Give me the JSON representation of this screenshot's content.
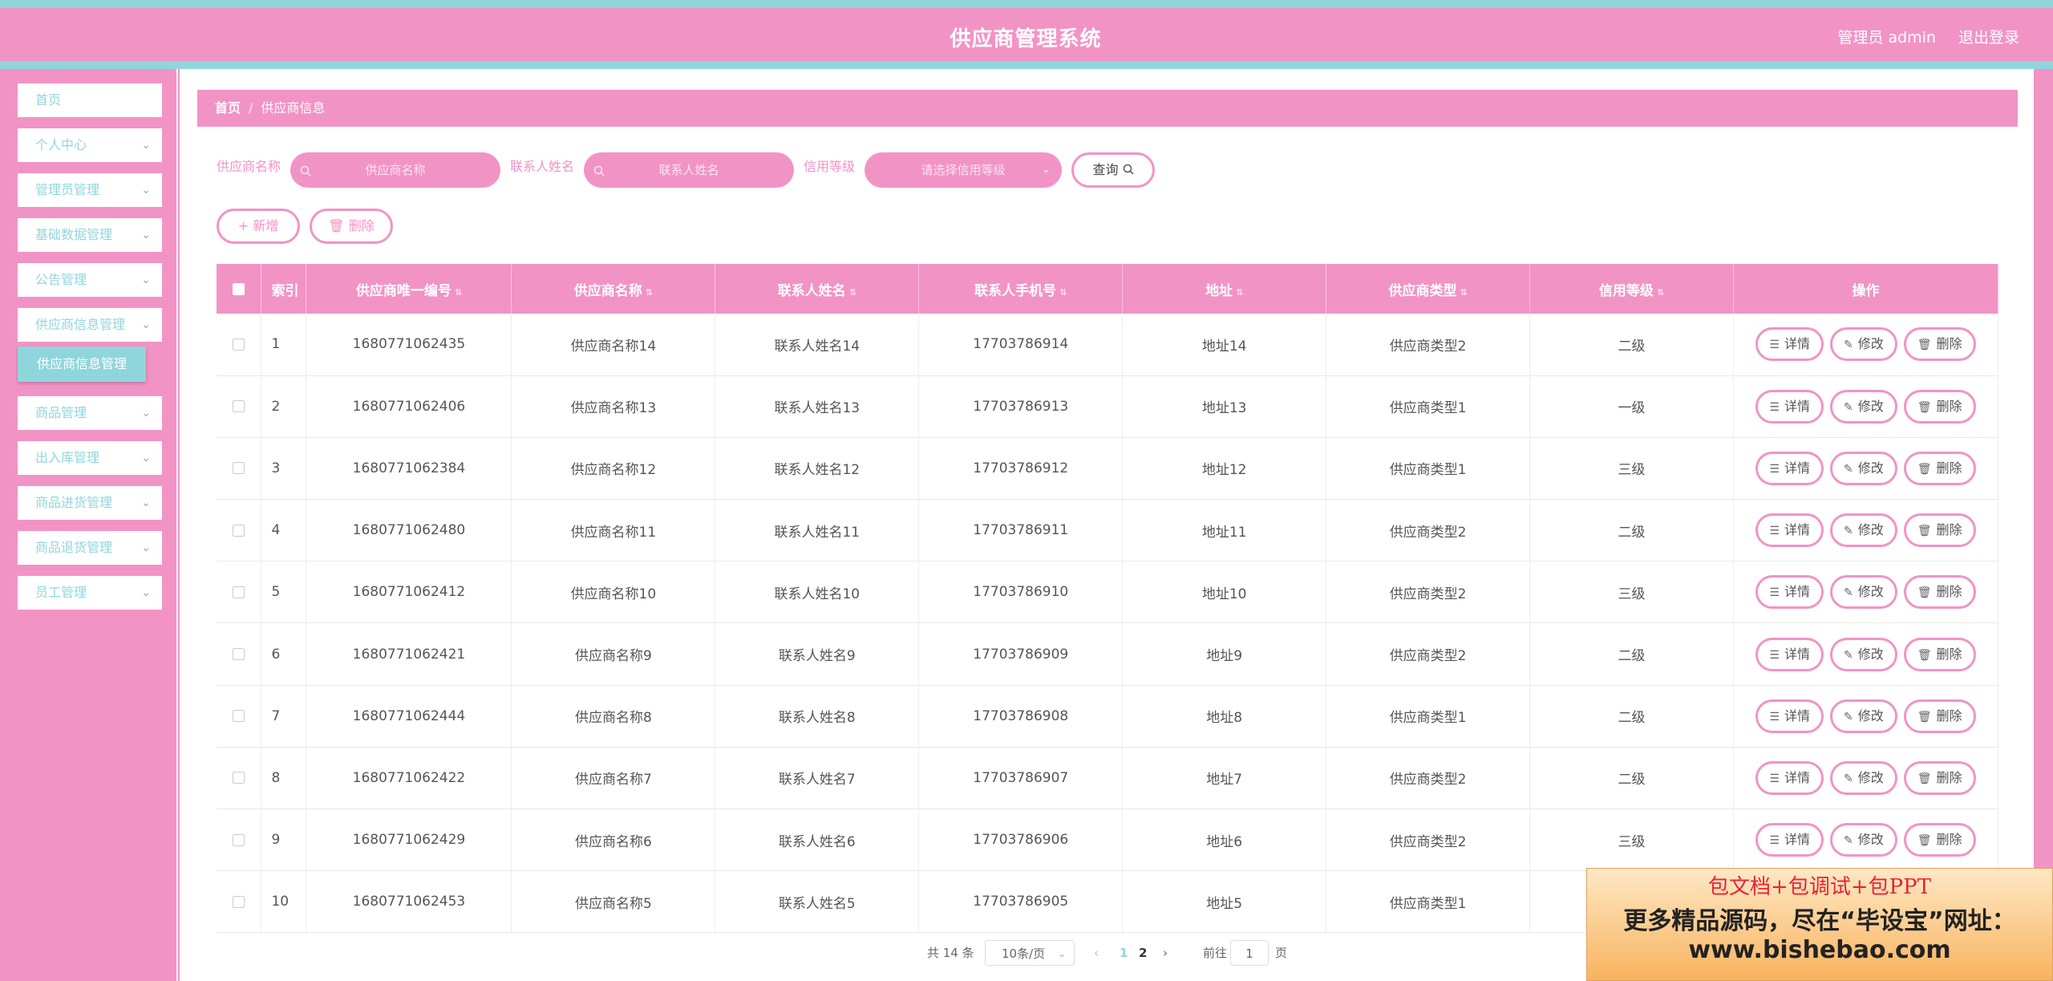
{
  "header": {
    "title": "供应商管理系统",
    "user_label": "管理员 admin",
    "logout_label": "退出登录"
  },
  "sidebar": {
    "items": [
      {
        "label": "首页",
        "has_children": false
      },
      {
        "label": "个人中心",
        "has_children": true
      },
      {
        "label": "管理员管理",
        "has_children": true
      },
      {
        "label": "基础数据管理",
        "has_children": true
      },
      {
        "label": "公告管理",
        "has_children": true
      },
      {
        "label": "供应商信息管理",
        "has_children": true
      },
      {
        "label": "商品管理",
        "has_children": true
      },
      {
        "label": "出入库管理",
        "has_children": true
      },
      {
        "label": "商品进货管理",
        "has_children": true
      },
      {
        "label": "商品退货管理",
        "has_children": true
      },
      {
        "label": "员工管理",
        "has_children": true
      }
    ],
    "active_sub": "供应商信息管理"
  },
  "breadcrumb": {
    "home": "首页",
    "separator": "/",
    "current": "供应商信息"
  },
  "filters": {
    "name_label": "供应商名称",
    "name_placeholder": "供应商名称",
    "contact_label": "联系人姓名",
    "contact_placeholder": "联系人姓名",
    "credit_label": "信用等级",
    "credit_placeholder": "请选择信用等级",
    "query_label": "查询"
  },
  "actions": {
    "add_label": "新增",
    "delete_label": "删除"
  },
  "table": {
    "columns": [
      "索引",
      "供应商唯一编号",
      "供应商名称",
      "联系人姓名",
      "联系人手机号",
      "地址",
      "供应商类型",
      "信用等级",
      "操作"
    ],
    "row_actions": {
      "detail": "详情",
      "edit": "修改",
      "delete": "删除"
    },
    "rows": [
      {
        "idx": "1",
        "code": "1680771062435",
        "name": "供应商名称14",
        "contact": "联系人姓名14",
        "phone": "17703786914",
        "address": "地址14",
        "type": "供应商类型2",
        "credit": "二级"
      },
      {
        "idx": "2",
        "code": "1680771062406",
        "name": "供应商名称13",
        "contact": "联系人姓名13",
        "phone": "17703786913",
        "address": "地址13",
        "type": "供应商类型1",
        "credit": "一级"
      },
      {
        "idx": "3",
        "code": "1680771062384",
        "name": "供应商名称12",
        "contact": "联系人姓名12",
        "phone": "17703786912",
        "address": "地址12",
        "type": "供应商类型1",
        "credit": "三级"
      },
      {
        "idx": "4",
        "code": "1680771062480",
        "name": "供应商名称11",
        "contact": "联系人姓名11",
        "phone": "17703786911",
        "address": "地址11",
        "type": "供应商类型2",
        "credit": "二级"
      },
      {
        "idx": "5",
        "code": "1680771062412",
        "name": "供应商名称10",
        "contact": "联系人姓名10",
        "phone": "17703786910",
        "address": "地址10",
        "type": "供应商类型2",
        "credit": "三级"
      },
      {
        "idx": "6",
        "code": "1680771062421",
        "name": "供应商名称9",
        "contact": "联系人姓名9",
        "phone": "17703786909",
        "address": "地址9",
        "type": "供应商类型2",
        "credit": "二级"
      },
      {
        "idx": "7",
        "code": "1680771062444",
        "name": "供应商名称8",
        "contact": "联系人姓名8",
        "phone": "17703786908",
        "address": "地址8",
        "type": "供应商类型1",
        "credit": "二级"
      },
      {
        "idx": "8",
        "code": "1680771062422",
        "name": "供应商名称7",
        "contact": "联系人姓名7",
        "phone": "17703786907",
        "address": "地址7",
        "type": "供应商类型2",
        "credit": "二级"
      },
      {
        "idx": "9",
        "code": "1680771062429",
        "name": "供应商名称6",
        "contact": "联系人姓名6",
        "phone": "17703786906",
        "address": "地址6",
        "type": "供应商类型2",
        "credit": "三级"
      },
      {
        "idx": "10",
        "code": "1680771062453",
        "name": "供应商名称5",
        "contact": "联系人姓名5",
        "phone": "17703786905",
        "address": "地址5",
        "type": "供应商类型1",
        "credit": ""
      }
    ]
  },
  "pagination": {
    "total_text": "共 14 条",
    "page_size": "10条/页",
    "pages": [
      "1",
      "2"
    ],
    "current_page": "1",
    "goto_label": "前往",
    "goto_value": "1",
    "page_suffix": "页"
  },
  "promo": {
    "line1": "包文档+包调试+包PPT",
    "line2": "更多精品源码，尽在“毕设宝”网址：",
    "line3": "www.bishebao.com"
  },
  "colors": {
    "primary_pink": "#f293c6",
    "accent_teal": "#8fd6dc"
  },
  "icons": {
    "search": "magnifier",
    "chevron": "chevron-down",
    "add": "plus",
    "trash": "trash",
    "doc": "document",
    "edit": "pencil"
  }
}
